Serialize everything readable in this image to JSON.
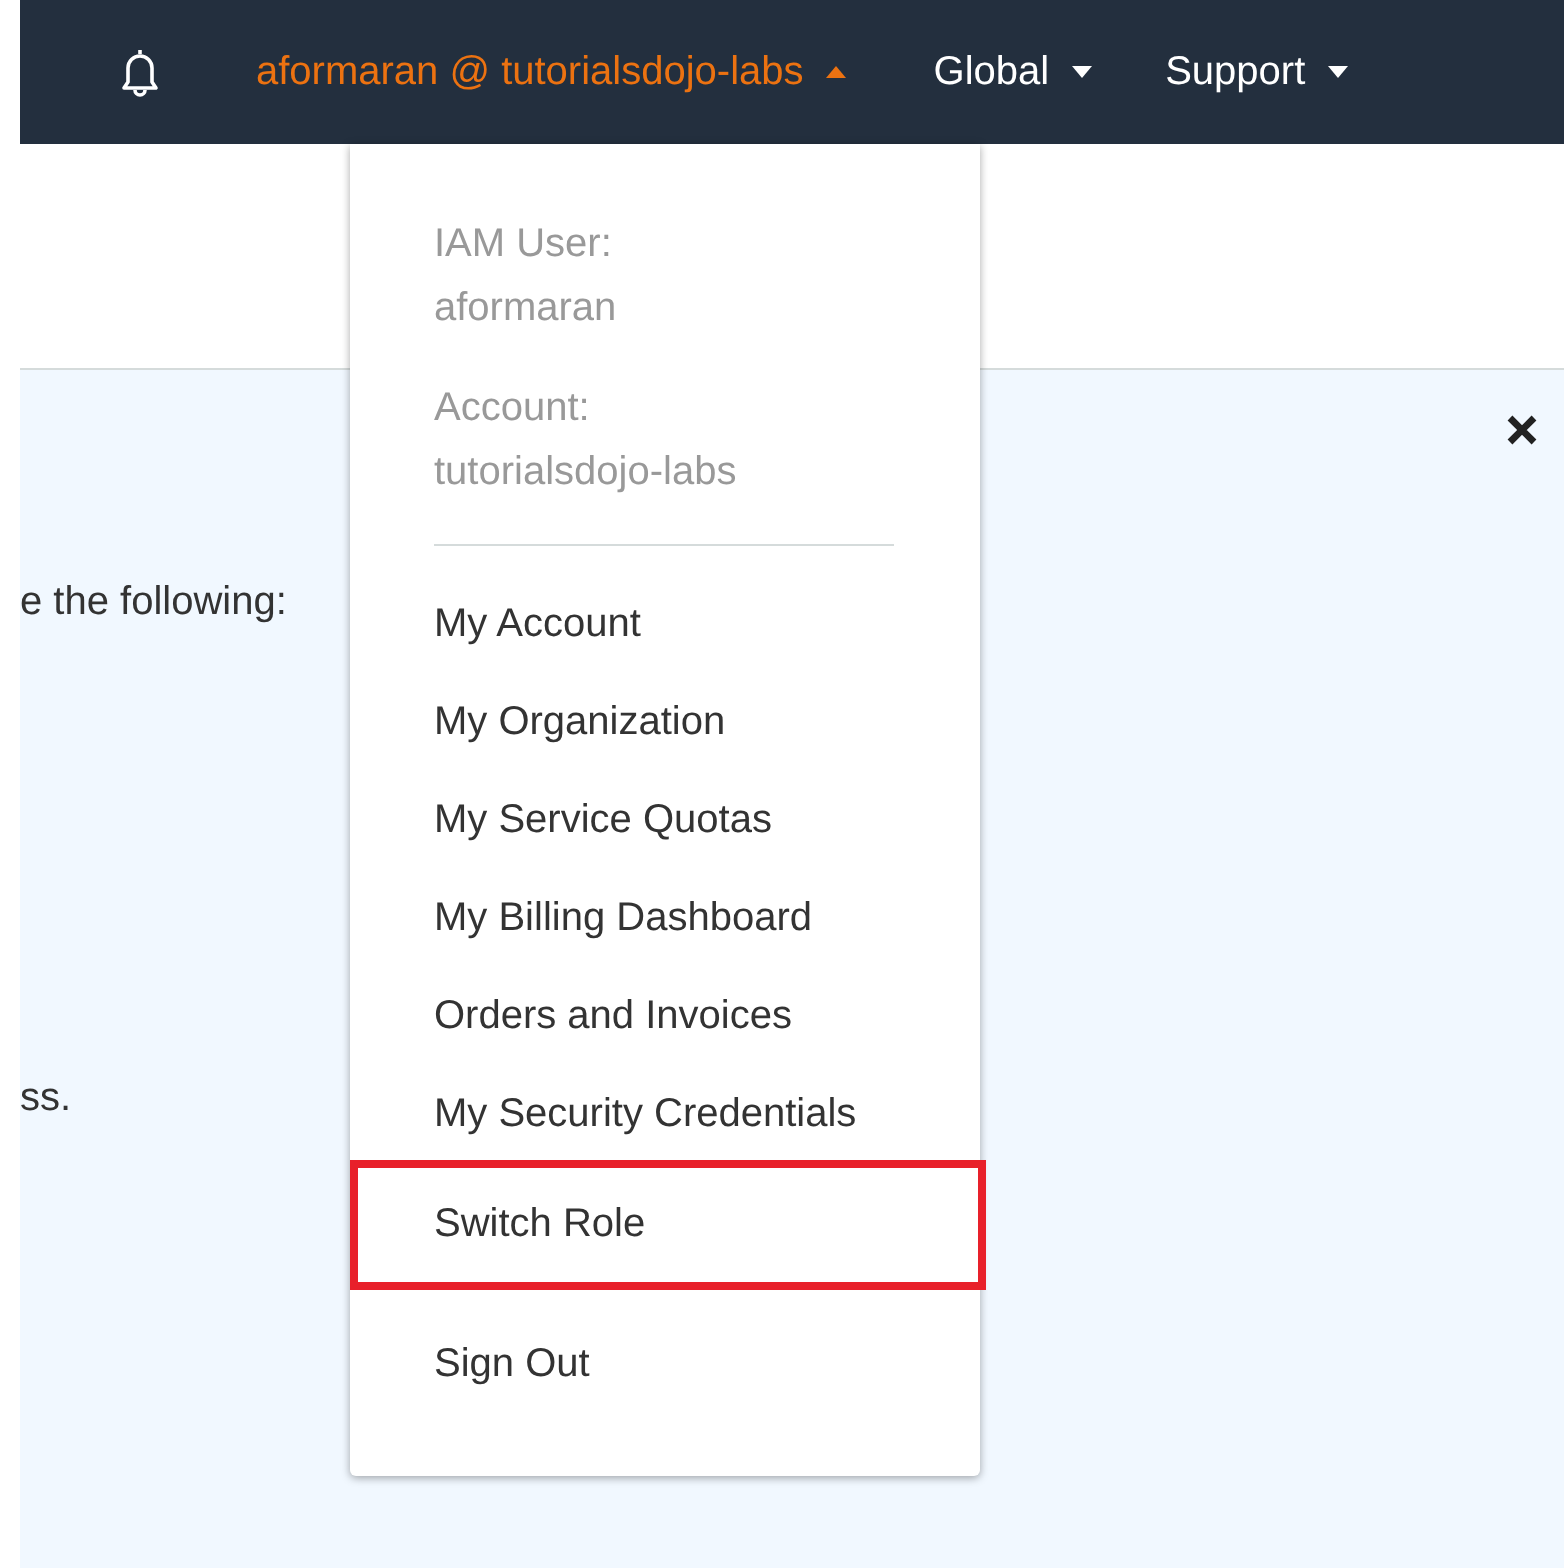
{
  "top_bar": {
    "account_label": "aformaran @ tutorialsdojo-labs",
    "account_menu_open": true,
    "menus": [
      {
        "label": "Global"
      },
      {
        "label": "Support"
      }
    ]
  },
  "account_menu": {
    "info": [
      {
        "label": "IAM User:",
        "value": "aformaran"
      },
      {
        "label": "Account:",
        "value": "tutorialsdojo-labs"
      }
    ],
    "items": [
      {
        "label": "My Account",
        "highlighted": false
      },
      {
        "label": "My Organization",
        "highlighted": false
      },
      {
        "label": "My Service Quotas",
        "highlighted": false
      },
      {
        "label": "My Billing Dashboard",
        "highlighted": false
      },
      {
        "label": "Orders and Invoices",
        "highlighted": false
      },
      {
        "label": "My Security Credentials",
        "highlighted": false
      },
      {
        "label": "Switch Role",
        "highlighted": true
      }
    ],
    "sign_out": {
      "label": "Sign Out"
    }
  },
  "content": {
    "paragraphs": [
      "e the following:",
      "ss."
    ]
  }
}
